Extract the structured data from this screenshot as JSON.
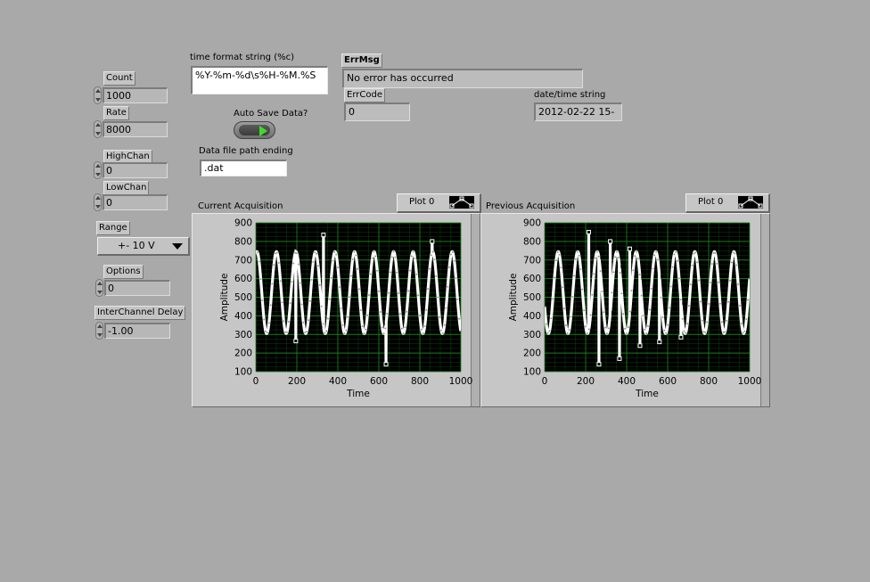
{
  "controls": {
    "count": {
      "label": "Count",
      "value": "1000"
    },
    "rate": {
      "label": "Rate",
      "value": "8000"
    },
    "high_chan": {
      "label": "HighChan",
      "value": "0"
    },
    "low_chan": {
      "label": "LowChan",
      "value": "0"
    },
    "range": {
      "label": "Range",
      "value": "+- 10 V"
    },
    "options": {
      "label": "Options",
      "value": "0"
    },
    "interchannel_delay": {
      "label": "InterChannel Delay",
      "value": "-1.00"
    }
  },
  "time_format": {
    "label": "time format string (%c)",
    "value": "%Y-%m-%d\\s%H-%M.%S"
  },
  "auto_save": {
    "label": "Auto Save Data?",
    "state": "on"
  },
  "data_file": {
    "label": "Data file path ending",
    "value": ".dat"
  },
  "error": {
    "msg_label": "ErrMsg",
    "msg_value": "No error has occurred",
    "code_label": "ErrCode",
    "code_value": "0"
  },
  "datetime": {
    "label": "date/time string",
    "value": "2012-02-22 15-"
  },
  "colors": {
    "plot_bg": "#000000",
    "grid": "#1f8a1f",
    "trace": "#ffffff",
    "led_on": "#3fdc2c"
  },
  "chart_data": [
    {
      "type": "line",
      "title": "Current Acquisition",
      "legend": "Plot 0",
      "xlabel": "Time",
      "ylabel": "Amplitude",
      "xlim": [
        0,
        1000
      ],
      "ylim": [
        100,
        900
      ],
      "xticks": [
        "0",
        "200",
        "400",
        "600",
        "800",
        "1000"
      ],
      "yticks": [
        "100",
        "200",
        "300",
        "400",
        "500",
        "600",
        "700",
        "800",
        "900"
      ],
      "grid": true,
      "series": [
        {
          "waveform": "sine",
          "center": 525,
          "amplitude": 220,
          "cycles": 10.5,
          "phase_deg": 70,
          "outliers": [
            [
              195,
              265
            ],
            [
              330,
              835
            ],
            [
              635,
              140
            ],
            [
              860,
              800
            ]
          ]
        }
      ]
    },
    {
      "type": "line",
      "title": "Previous Acquisition",
      "legend": "Plot 0",
      "xlabel": "Time",
      "ylabel": "Amplitude",
      "xlim": [
        0,
        1000
      ],
      "ylim": [
        100,
        900
      ],
      "xticks": [
        "0",
        "200",
        "400",
        "600",
        "800",
        "1000"
      ],
      "yticks": [
        "100",
        "200",
        "300",
        "400",
        "500",
        "600",
        "700",
        "800",
        "900"
      ],
      "grid": true,
      "series": [
        {
          "waveform": "sine",
          "center": 525,
          "amplitude": 220,
          "cycles": 10.5,
          "phase_deg": 200,
          "outliers": [
            [
              215,
              850
            ],
            [
              265,
              140
            ],
            [
              320,
              800
            ],
            [
              365,
              170
            ],
            [
              415,
              760
            ],
            [
              465,
              240
            ],
            [
              560,
              260
            ],
            [
              665,
              285
            ]
          ]
        }
      ]
    }
  ]
}
